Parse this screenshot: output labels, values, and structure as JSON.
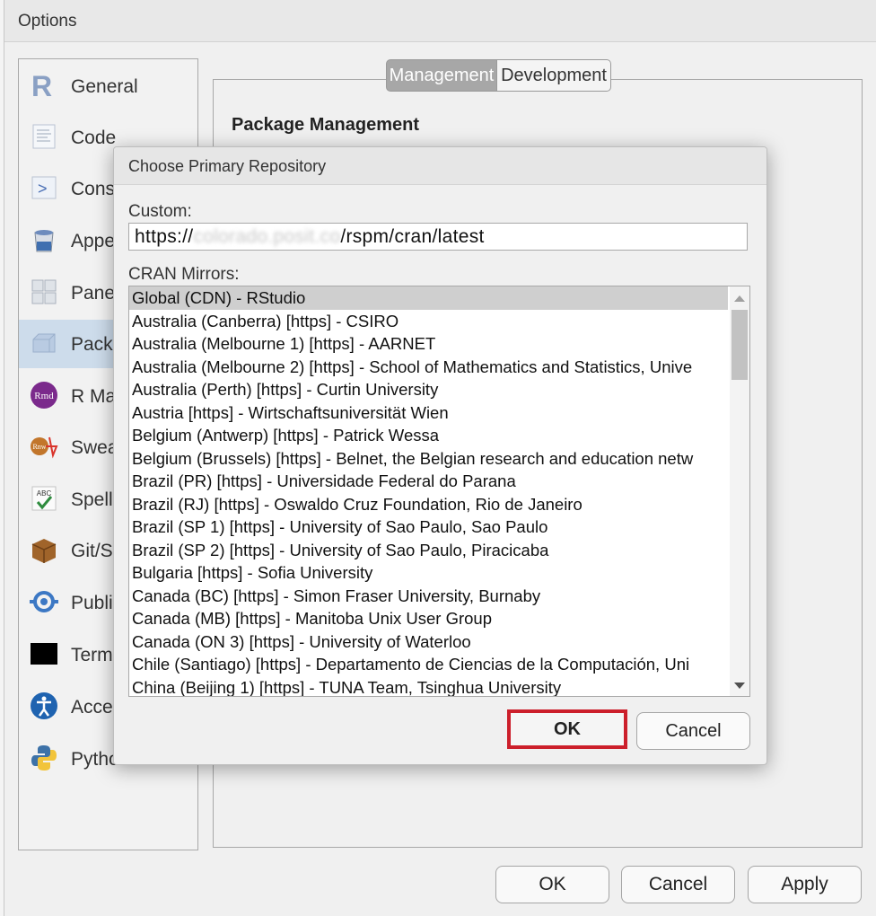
{
  "window": {
    "title": "Options"
  },
  "sidebar": {
    "items": [
      {
        "label": "General",
        "icon": "r-logo-icon"
      },
      {
        "label": "Code",
        "icon": "code-document-icon"
      },
      {
        "label": "Cons",
        "icon": "console-icon"
      },
      {
        "label": "Appe",
        "icon": "paint-bucket-icon"
      },
      {
        "label": "Pane",
        "icon": "pane-layout-icon"
      },
      {
        "label": "Packa",
        "icon": "package-box-icon"
      },
      {
        "label": "R Ma",
        "icon": "rmd-icon"
      },
      {
        "label": "Swea",
        "icon": "sweave-icon"
      },
      {
        "label": "Spelli",
        "icon": "spelling-icon"
      },
      {
        "label": "Git/S",
        "icon": "git-box-icon"
      },
      {
        "label": "Publi",
        "icon": "publishing-icon"
      },
      {
        "label": "Term",
        "icon": "terminal-icon"
      },
      {
        "label": "Acces",
        "icon": "accessibility-icon"
      },
      {
        "label": "Python",
        "icon": "python-icon"
      }
    ]
  },
  "tabs": {
    "management": "Management",
    "development": "Development"
  },
  "section": {
    "heading": "Package Management"
  },
  "footer": {
    "ok": "OK",
    "cancel": "Cancel",
    "apply": "Apply"
  },
  "dialog": {
    "title": "Choose Primary Repository",
    "custom_label": "Custom:",
    "custom_prefix": "https://",
    "custom_obscured": "colorado.posit.co",
    "custom_suffix": "/rspm/cran/latest",
    "mirrors_label": "CRAN Mirrors:",
    "mirrors": [
      "Global (CDN) - RStudio",
      "Australia (Canberra) [https] - CSIRO",
      "Australia (Melbourne 1) [https] - AARNET",
      "Australia (Melbourne 2) [https] - School of Mathematics and Statistics, Unive",
      "Australia (Perth) [https] - Curtin University",
      "Austria [https] - Wirtschaftsuniversität Wien",
      "Belgium (Antwerp) [https] - Patrick Wessa",
      "Belgium (Brussels) [https] - Belnet, the Belgian research and education netw",
      "Brazil (PR) [https] - Universidade Federal do Parana",
      "Brazil (RJ) [https] - Oswaldo Cruz Foundation, Rio de Janeiro",
      "Brazil (SP 1) [https] - University of Sao Paulo, Sao Paulo",
      "Brazil (SP 2) [https] - University of Sao Paulo, Piracicaba",
      "Bulgaria [https] - Sofia University",
      "Canada (BC) [https] - Simon Fraser University, Burnaby",
      "Canada (MB) [https] - Manitoba Unix User Group",
      "Canada (ON 3) [https] - University of Waterloo",
      "Chile (Santiago) [https] - Departamento de Ciencias de la Computación, Uni",
      "China (Beijing 1) [https] - TUNA Team, Tsinghua University"
    ],
    "ok": "OK",
    "cancel": "Cancel",
    "highlight_color": "#cc1f2b"
  }
}
